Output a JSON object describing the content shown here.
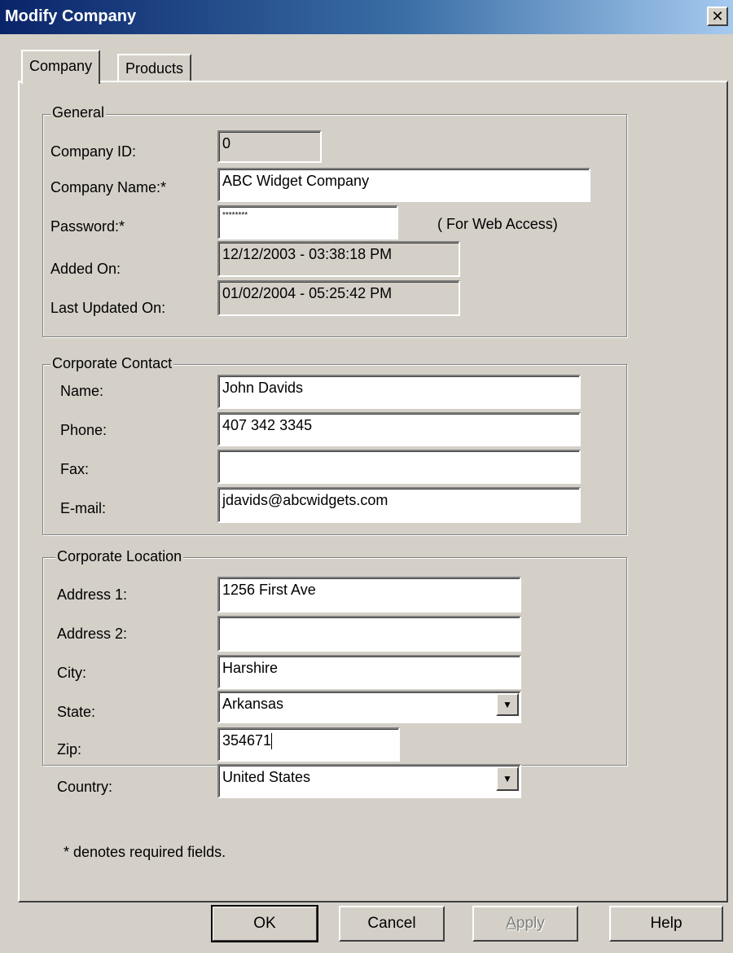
{
  "window": {
    "title": "Modify Company",
    "close_glyph": "✕"
  },
  "tabs": [
    {
      "label": "Company",
      "active": true
    },
    {
      "label": "Products",
      "active": false
    }
  ],
  "general": {
    "legend": "General",
    "company_id_label": "Company ID:",
    "company_id_value": "0",
    "company_name_label": "Company Name:*",
    "company_name_value": "ABC Widget Company",
    "password_label": "Password:*",
    "password_value": "********",
    "password_hint": "( For Web Access)",
    "added_on_label": "Added On:",
    "added_on_value": "12/12/2003 - 03:38:18 PM",
    "last_updated_label": "Last Updated On:",
    "last_updated_value": "01/02/2004 - 05:25:42 PM"
  },
  "contact": {
    "legend": "Corporate Contact",
    "name_label": "Name:",
    "name_value": "John Davids",
    "phone_label": "Phone:",
    "phone_value": "407 342 3345",
    "fax_label": "Fax:",
    "fax_value": "",
    "email_label": "E-mail:",
    "email_value": "jdavids@abcwidgets.com"
  },
  "location": {
    "legend": "Corporate Location",
    "address1_label": "Address 1:",
    "address1_value": "1256 First Ave",
    "address2_label": "Address 2:",
    "address2_value": "",
    "city_label": "City:",
    "city_value": "Harshire",
    "state_label": "State:",
    "state_value": "Arkansas",
    "zip_label": "Zip:",
    "zip_value": "354671",
    "country_label": "Country:",
    "country_value": "United States"
  },
  "footnote": "* denotes required fields.",
  "buttons": {
    "ok": "OK",
    "cancel": "Cancel",
    "apply": "Apply",
    "apply_accel": "A",
    "apply_rest": "pply",
    "help": "Help"
  },
  "icons": {
    "dropdown_arrow": "▼"
  }
}
